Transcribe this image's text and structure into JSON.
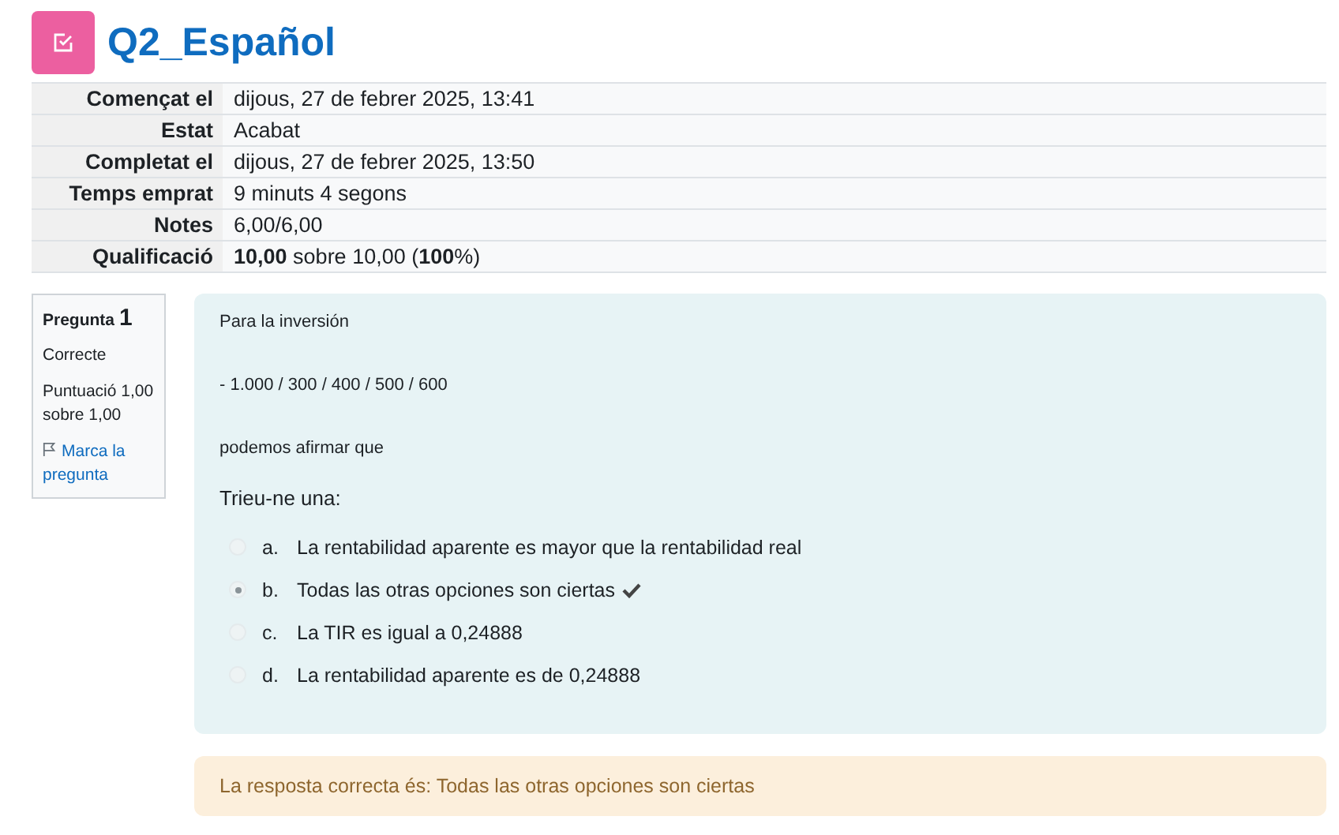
{
  "title": "Q2_Español",
  "summary": [
    {
      "label": "Començat el",
      "value": "dijous, 27 de febrer 2025, 13:41"
    },
    {
      "label": "Estat",
      "value": "Acabat"
    },
    {
      "label": "Completat el",
      "value": "dijous, 27 de febrer 2025, 13:50"
    },
    {
      "label": "Temps emprat",
      "value": "9 minuts 4 segons"
    },
    {
      "label": "Notes",
      "value": "6,00/6,00"
    },
    {
      "label": "Qualificació",
      "value": "**10,00** sobre 10,00 (**100**%)"
    }
  ],
  "question_info": {
    "label": "Pregunta",
    "number": "1",
    "state": "Correcte",
    "grade": "Puntuació 1,00 sobre 1,00",
    "flag": "Marca la pregunta"
  },
  "question": {
    "paragraphs": [
      "Para la inversión",
      "- 1.000 / 300 / 400 / 500 / 600",
      "podemos afirmar que"
    ],
    "prompt": "Trieu-ne una:",
    "options": [
      {
        "letter": "a.",
        "text": "La rentabilidad aparente es mayor que la rentabilidad real",
        "selected": false,
        "correct": false
      },
      {
        "letter": "b.",
        "text": "Todas las otras opciones son ciertas",
        "selected": true,
        "correct": true
      },
      {
        "letter": "c.",
        "text": "La TIR es igual a 0,24888",
        "selected": false,
        "correct": false
      },
      {
        "letter": "d.",
        "text": "La rentabilidad aparente es de 0,24888",
        "selected": false,
        "correct": false
      }
    ]
  },
  "feedback": "La resposta correcta és: Todas las otras opciones son ciertas"
}
